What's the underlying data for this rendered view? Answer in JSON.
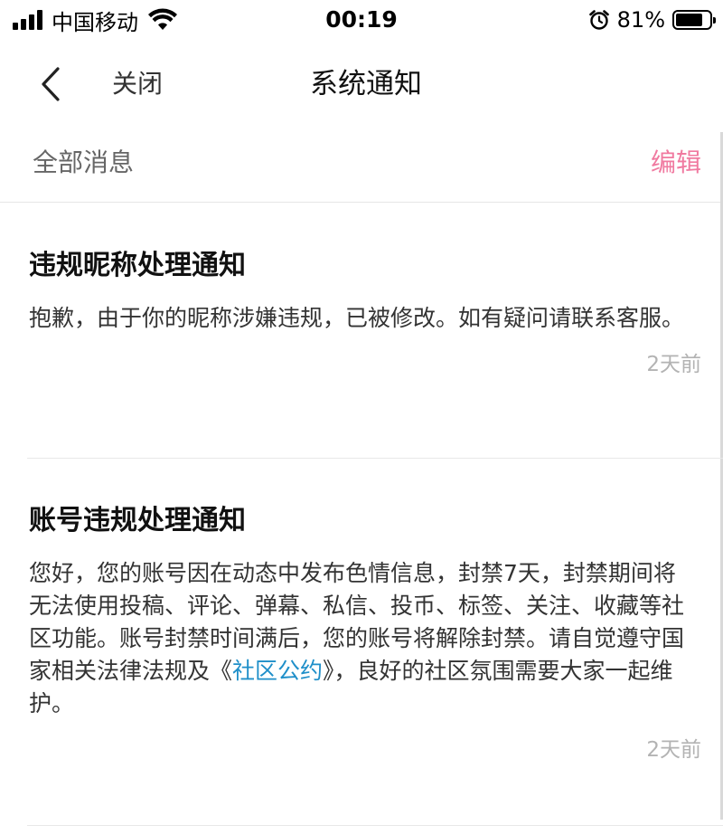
{
  "status_bar": {
    "carrier": "中国移动",
    "time": "00:19",
    "battery_percent": "81%",
    "battery_level": 0.81,
    "icons": [
      "signal-icon",
      "wifi-icon",
      "alarm-icon",
      "battery-icon"
    ]
  },
  "nav": {
    "back_icon": "chevron-left-icon",
    "close_label": "关闭",
    "title": "系统通知"
  },
  "section": {
    "title": "全部消息",
    "edit_label": "编辑"
  },
  "notices": [
    {
      "title": "违规昵称处理通知",
      "body": "抱歉，由于你的昵称涉嫌违规，已被修改。如有疑问请联系客服。",
      "time": "2天前"
    },
    {
      "title": "账号违规处理通知",
      "body_before_link": "您好，您的账号因在动态中发布色情信息，封禁7天，封禁期间将无法使用投稿、评论、弹幕、私信、投币、标签、关注、收藏等社区功能。账号封禁时间满后，您的账号将解除封禁。请自觉遵守国家相关法律法规及《",
      "link_text": "社区公约",
      "body_after_link": "》，良好的社区氛围需要大家一起维护。",
      "time": "2天前"
    }
  ],
  "colors": {
    "accent_edit": "#f07aa0",
    "link": "#1f8fc9",
    "muted": "#b3b3b3"
  }
}
